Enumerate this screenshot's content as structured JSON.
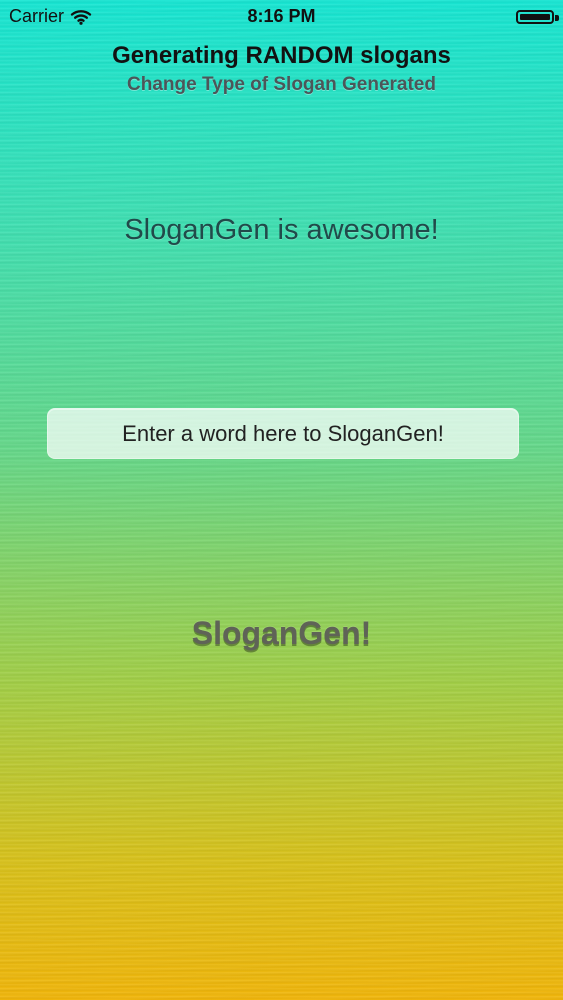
{
  "status_bar": {
    "carrier": "Carrier",
    "time": "8:16 PM",
    "wifi_icon": "wifi-icon",
    "battery_icon": "battery-icon"
  },
  "header": {
    "title": "Generating RANDOM slogans",
    "subtitle": "Change Type of Slogan Generated"
  },
  "main": {
    "slogan": "SloganGen is awesome!",
    "input_placeholder": "Enter a word here to SloganGen!",
    "generate_label": "SloganGen!"
  },
  "colors": {
    "top": "#17e6d3",
    "middle": "#66d88a",
    "bottom": "#f1b60b"
  }
}
